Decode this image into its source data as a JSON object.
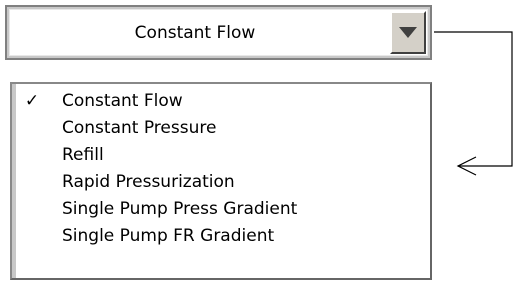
{
  "combo": {
    "selected_value": "Constant Flow",
    "dropdown_icon": "chevron-down-icon"
  },
  "list": {
    "items": [
      {
        "label": "Constant Flow",
        "checked": true
      },
      {
        "label": "Constant Pressure",
        "checked": false
      },
      {
        "label": "Refill",
        "checked": false
      },
      {
        "label": "Rapid Pressurization",
        "checked": false
      },
      {
        "label": "Single Pump Press Gradient",
        "checked": false
      },
      {
        "label": "Single Pump FR Gradient",
        "checked": false
      }
    ],
    "check_mark": "✓",
    "check_icon": "checkmark-icon"
  },
  "connector": {
    "icon": "arrow-left-icon"
  },
  "colors": {
    "frame": "#808080",
    "button_face": "#d4d0c8",
    "arrow": "#404040"
  }
}
